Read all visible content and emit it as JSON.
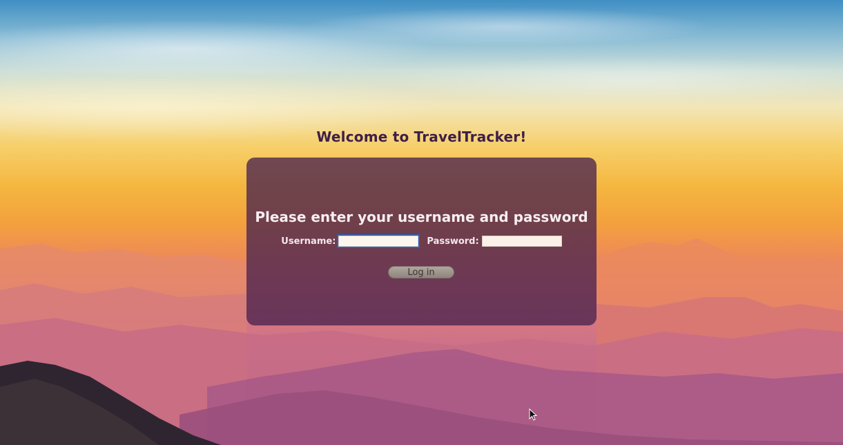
{
  "page": {
    "title": "Welcome to TravelTracker!"
  },
  "login": {
    "heading": "Please enter your username and password",
    "username_label": "Username:",
    "username_value": "",
    "password_label": "Password:",
    "password_value": "",
    "submit_label": "Log in"
  },
  "background": {
    "scene": "sunset-mountains"
  },
  "colors": {
    "title_text": "#3f1f48",
    "panel_bg": "#4a244e",
    "panel_text": "#f6eef2",
    "button_bg": "#9e958d"
  }
}
